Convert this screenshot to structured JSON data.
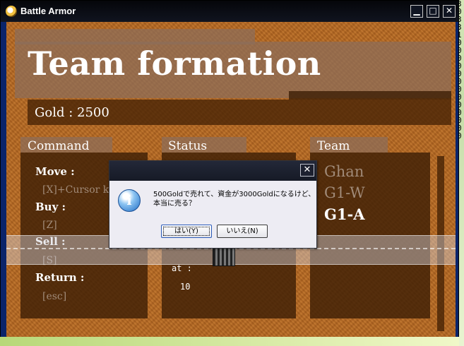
{
  "window": {
    "title": "Battle Armor",
    "minimize_symbol": "▁",
    "maximize_symbol": "□",
    "close_symbol": "✕"
  },
  "right_strip_digits": [
    "3",
    "0",
    "3",
    "3",
    "1",
    "0",
    "0",
    "0",
    "0",
    "0",
    "0",
    "0",
    "0",
    "0",
    "0",
    "0",
    "0",
    "0"
  ],
  "header": {
    "title": "Team formation",
    "gold_label": "Gold : 2500"
  },
  "sections": {
    "command_title": "Command",
    "status_title": "Status",
    "team_title": "Team"
  },
  "commands": [
    {
      "label": "Move :",
      "key": "[X]+Cursor k"
    },
    {
      "label": "Buy :",
      "key": "[Z]"
    },
    {
      "label": "Sell :",
      "key": "[S]"
    },
    {
      "label": "Return :",
      "key": "[esc]"
    }
  ],
  "status": {
    "at_label": "at :",
    "at_value": "10"
  },
  "team": [
    {
      "name": "Ghan",
      "color": "#a08a78"
    },
    {
      "name": "G1-W",
      "color": "#a08a78"
    },
    {
      "name": "G1-A",
      "color": "#ffffff"
    }
  ],
  "dialog": {
    "close_symbol": "✕",
    "icon_glyph": "i",
    "message_line1": "500Goldで売れて、資金が3000Goldになるけど、",
    "message_line2": "本当に売る？",
    "yes_label": "はい(Y)",
    "no_label": "いいえ(N)"
  },
  "colors": {
    "client_bg": "#b86a22",
    "panel_dark": "#46230a",
    "muted_text": "#a08a78",
    "titlebar": "#05060a"
  }
}
